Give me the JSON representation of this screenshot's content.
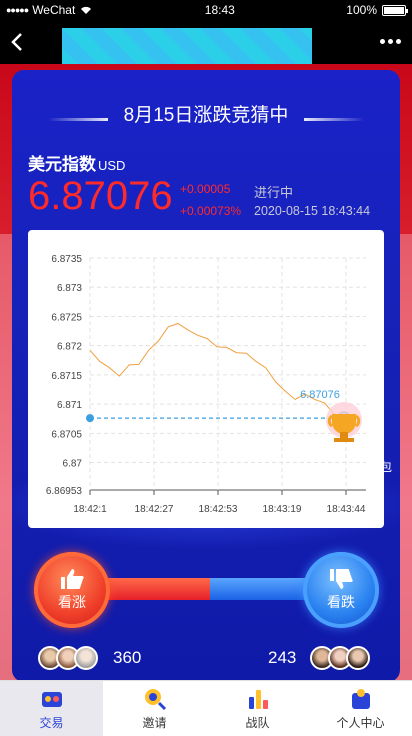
{
  "status_bar": {
    "carrier": "WeChat",
    "time": "18:43",
    "battery": "100%"
  },
  "colors": {
    "accent_blue": "#1a22c8",
    "up_red": "#ff2a2a",
    "chart_line": "#f0a040",
    "marker": "#3aa0e0"
  },
  "header": {
    "title": "8月15日涨跌竞猜中"
  },
  "quote": {
    "name": "美元指数",
    "unit": "USD",
    "price": "6.87076",
    "change_abs": "+0.00005",
    "change_pct": "+0.00073%",
    "state": "进行中",
    "datetime": "2020-08-15 18:43:44"
  },
  "chart_data": {
    "type": "line",
    "current_label": "6.87076",
    "yticks": [
      "6.8735",
      "6.873",
      "6.8725",
      "6.872",
      "6.8715",
      "6.871",
      "6.8705",
      "6.87",
      "6.86953"
    ],
    "xticks": [
      "18:42:1",
      "18:42:27",
      "18:42:53",
      "18:43:19",
      "18:43:44"
    ],
    "ylim": [
      6.86953,
      6.8735
    ],
    "series": [
      {
        "values": [
          6.8719,
          6.87175,
          6.8716,
          6.8715,
          6.87165,
          6.8717,
          6.8719,
          6.8721,
          6.8723,
          6.8724,
          6.87225,
          6.8722,
          6.8721,
          6.872,
          6.87195,
          6.8719,
          6.87185,
          6.87175,
          6.8716,
          6.8714,
          6.8712,
          6.8711,
          6.87115,
          6.8711,
          6.871,
          6.87085,
          6.87076
        ]
      }
    ]
  },
  "vote": {
    "up_label": "看涨",
    "down_label": "看跌",
    "up_count": "360",
    "down_count": "243"
  },
  "side_text": "包",
  "tabs": [
    {
      "label": "交易",
      "icon": "trade-icon"
    },
    {
      "label": "邀请",
      "icon": "invite-icon"
    },
    {
      "label": "战队",
      "icon": "team-icon"
    },
    {
      "label": "个人中心",
      "icon": "profile-icon"
    }
  ]
}
